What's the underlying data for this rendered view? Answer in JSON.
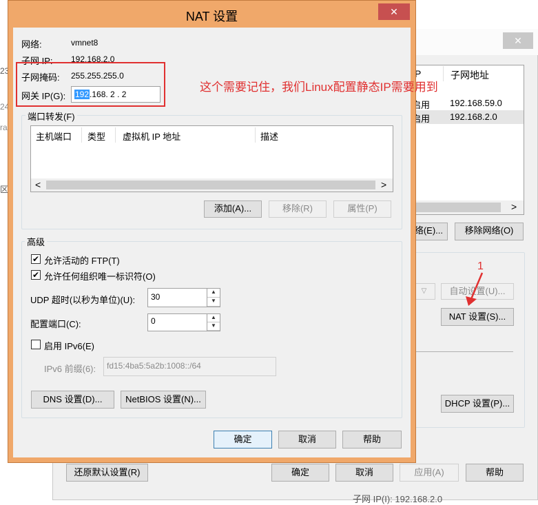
{
  "bg": {
    "header": {
      "col1": "P",
      "col2": "子网地址"
    },
    "rows": [
      {
        "c1": "启用",
        "c2": "192.168.59.0"
      },
      {
        "c1": "启用",
        "c2": "192.168.2.0"
      }
    ],
    "btn_props": "移除网络(O)",
    "btn_props_partial": "络(E)...",
    "btn_auto": "自动设置(U)...",
    "btn_nat": "NAT 设置(S)...",
    "btn_dhcp": "DHCP 设置(P)...",
    "btn_restore": "还原默认设置(R)",
    "btn_ok": "确定",
    "btn_cancel": "取消",
    "btn_apply": "应用(A)",
    "btn_help": "帮助",
    "left_glyphs": [
      "23",
      "24",
      "ra",
      "区"
    ],
    "arrow_number": "1",
    "bottom_text": "子网 IP(I): 192.168.2.0"
  },
  "dlg": {
    "title": "NAT 设置",
    "close": "✕",
    "network_label": "网络:",
    "network_value": "vmnet8",
    "subnet_ip_label": "子网 IP:",
    "subnet_ip_value": "192.168.2.0",
    "mask_label": "子网掩码:",
    "mask_value": "255.255.255.0",
    "gateway_label": "网关 IP(G):",
    "gw1": "192",
    "gw_rest": ".168. 2 . 2",
    "annotation": "这个需要记住，我们Linux配置静态IP需要用到",
    "pf_group": "端口转发(F)",
    "pf_cols": [
      "主机端口",
      "类型",
      "虚拟机 IP 地址",
      "描述"
    ],
    "btn_add": "添加(A)...",
    "btn_remove": "移除(R)",
    "btn_props": "属性(P)",
    "adv_group": "高级",
    "chk_ftp": "允许活动的 FTP(T)",
    "chk_org": "允许任何组织唯一标识符(O)",
    "udp_label": "UDP 超时(以秒为单位)(U):",
    "udp_value": "30",
    "port_label": "配置端口(C):",
    "port_value": "0",
    "ipv6_label": "启用 IPv6(E)",
    "prefix_label": "IPv6 前缀(6):",
    "prefix_value": "fd15:4ba5:5a2b:1008::/64",
    "btn_dns": "DNS 设置(D)...",
    "btn_netbios": "NetBIOS 设置(N)...",
    "btn_ok": "确定",
    "btn_cancel": "取消",
    "btn_help": "帮助",
    "check": "✔",
    "up": "▲",
    "down": "▼",
    "left": "<",
    "right": ">"
  },
  "colors": {
    "accent": "#f0a86a",
    "close": "#c75050",
    "annotation": "#e03030"
  }
}
